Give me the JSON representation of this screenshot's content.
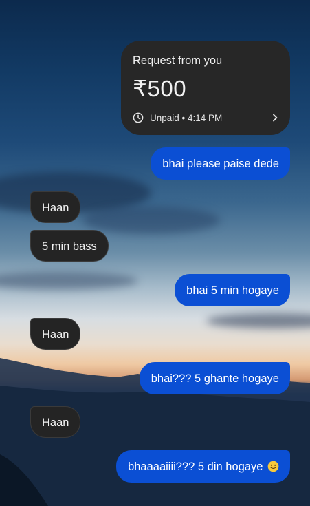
{
  "payment_request": {
    "title": "Request from you",
    "amount": "₹500",
    "status": "Unpaid • 4:14 PM",
    "icon": "clock-icon",
    "chevron": "chevron-right-icon"
  },
  "messages": [
    {
      "direction": "outgoing",
      "text": "bhai please paise dede"
    },
    {
      "direction": "incoming",
      "text": "Haan"
    },
    {
      "direction": "incoming",
      "text": "5 min bass"
    },
    {
      "direction": "outgoing",
      "text": "bhai 5 min hogaye"
    },
    {
      "direction": "incoming",
      "text": "Haan"
    },
    {
      "direction": "outgoing",
      "text": "bhai??? 5 ghante hogaye"
    },
    {
      "direction": "incoming",
      "text": "Haan"
    },
    {
      "direction": "outgoing",
      "text": "bhaaaaiiii??? 5 din hogaye",
      "emoji": "slightly-smiling-face"
    }
  ],
  "colors": {
    "outgoing_bubble": "#0b4fd4",
    "incoming_bubble": "#242424",
    "card": "#272727"
  }
}
